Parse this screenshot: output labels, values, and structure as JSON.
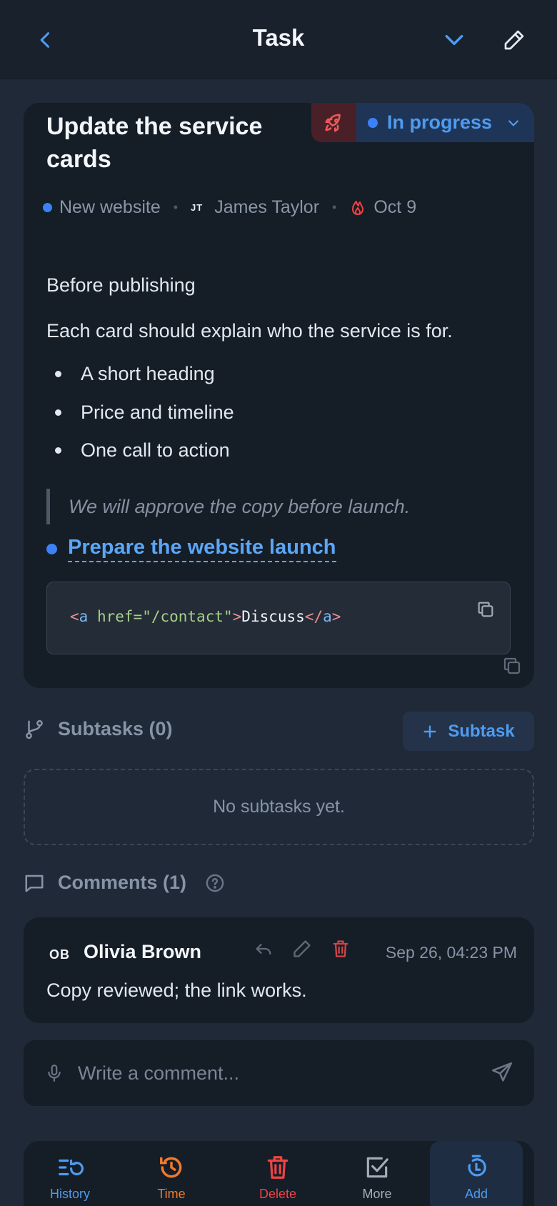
{
  "header": {
    "title": "Task"
  },
  "task": {
    "title": "Update the service cards",
    "status": "In progress",
    "project": "New website",
    "assignee_initials": "JT",
    "assignee": "James Taylor",
    "due_date": "Oct 9"
  },
  "description": {
    "paragraph1": "Before publishing",
    "paragraph2": "Each card should explain who the service is for.",
    "bullets": [
      "A short heading",
      "Price and timeline",
      "One call to action"
    ],
    "quote": "We will approve the copy before launch.",
    "linked_task": "Prepare the website launch",
    "code": {
      "open_lt": "<",
      "tag": "a",
      "attr": "href",
      "eq": "=",
      "value": "\"/contact\"",
      "gt": ">",
      "text": "Discuss",
      "close_open": "</",
      "close_tag": "a",
      "close_gt": ">"
    }
  },
  "subtasks": {
    "header": "Subtasks (0)",
    "add_label": "Subtask",
    "empty_text": "No subtasks yet."
  },
  "comments": {
    "header": "Comments (1)",
    "items": [
      {
        "initials": "OB",
        "author": "Olivia Brown",
        "timestamp": "Sep 26, 04:23 PM",
        "text": "Copy reviewed; the link works."
      }
    ],
    "input_placeholder": "Write a comment..."
  },
  "bottom_bar": {
    "items": [
      {
        "label": "History",
        "color": "#4e9bf2"
      },
      {
        "label": "Time",
        "color": "#f07a2c"
      },
      {
        "label": "Delete",
        "color": "#ef4444"
      },
      {
        "label": "More",
        "color": "#a3adba"
      },
      {
        "label": "Add",
        "color": "#4e9bf2"
      }
    ]
  },
  "colors": {
    "accent": "#4e9bf2",
    "danger": "#ef4444",
    "background": "#1f2938",
    "card": "#151d27"
  },
  "icons": [
    "back-icon",
    "chevron-down-icon",
    "edit-icon",
    "rocket-icon",
    "flame-icon",
    "copy-icon",
    "branch-icon",
    "plus-icon",
    "comment-icon",
    "help-icon",
    "reply-icon",
    "pencil-icon",
    "trash-icon",
    "mic-icon",
    "send-icon",
    "history-icon",
    "clock-icon",
    "check-square-icon",
    "timer-icon"
  ]
}
